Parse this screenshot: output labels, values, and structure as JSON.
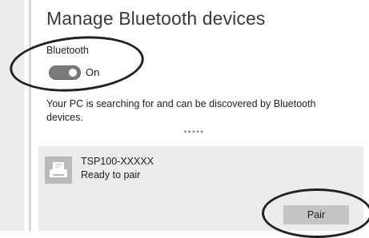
{
  "settings": {
    "title": "Manage Bluetooth devices",
    "bluetooth_label": "Bluetooth",
    "toggle_state": "On",
    "status_text": "Your PC is searching for and can be discovered by Bluetooth devices.",
    "progress_dots": "•••••"
  },
  "device": {
    "name": "TSP100-XXXXX",
    "status": "Ready to pair",
    "icon": "printer-icon",
    "pair_label": "Pair"
  },
  "colors": {
    "toggle_on": "#7b7b7b",
    "panel_bg": "#ececec",
    "button_bg": "#c4c4c4",
    "annotation_circle": "#222222"
  }
}
